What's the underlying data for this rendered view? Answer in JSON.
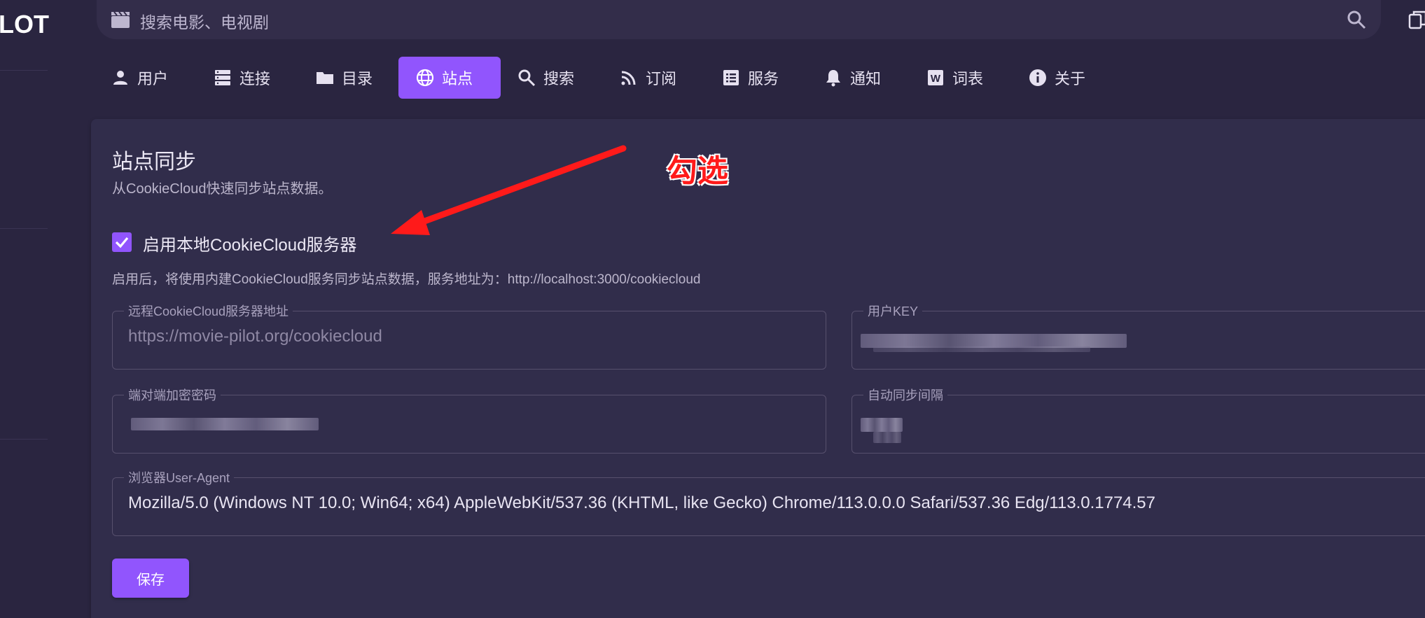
{
  "app": {
    "logo_text": "LOT"
  },
  "search": {
    "placeholder": "搜索电影、电视剧"
  },
  "tabs": [
    {
      "label": "用户",
      "icon": "user-icon",
      "active": false
    },
    {
      "label": "连接",
      "icon": "server-icon",
      "active": false
    },
    {
      "label": "目录",
      "icon": "folder-icon",
      "active": false
    },
    {
      "label": "站点",
      "icon": "globe-icon",
      "active": true
    },
    {
      "label": "搜索",
      "icon": "search-icon",
      "active": false
    },
    {
      "label": "订阅",
      "icon": "rss-icon",
      "active": false
    },
    {
      "label": "服务",
      "icon": "list-icon",
      "active": false
    },
    {
      "label": "通知",
      "icon": "bell-icon",
      "active": false
    },
    {
      "label": "词表",
      "icon": "word-icon",
      "active": false
    },
    {
      "label": "关于",
      "icon": "info-icon",
      "active": false
    }
  ],
  "card": {
    "title": "站点同步",
    "subtitle": "从CookieCloud快速同步站点数据。",
    "checkbox_label": "启用本地CookieCloud服务器",
    "checkbox_checked": true,
    "hint": "启用后，将使用内建CookieCloud服务同步站点数据，服务地址为：http://localhost:3000/cookiecloud",
    "fields": {
      "remote_url": {
        "label": "远程CookieCloud服务器地址",
        "value": "https://movie-pilot.org/cookiecloud"
      },
      "user_key": {
        "label": "用户KEY",
        "value": ""
      },
      "password": {
        "label": "端对端加密密码",
        "value": ""
      },
      "interval": {
        "label": "自动同步间隔",
        "value": ""
      },
      "user_agent": {
        "label": "浏览器User-Agent",
        "value": "Mozilla/5.0 (Windows NT 10.0; Win64; x64) AppleWebKit/537.36 (KHTML, like Gecko) Chrome/113.0.0.0 Safari/537.36 Edg/113.0.1774.57"
      }
    },
    "save_label": "保存"
  },
  "annotation": {
    "text": "勾选",
    "color": "#ff1a1a"
  },
  "colors": {
    "accent": "#9155fd",
    "background": "#2a2540",
    "card": "#312d4b"
  }
}
